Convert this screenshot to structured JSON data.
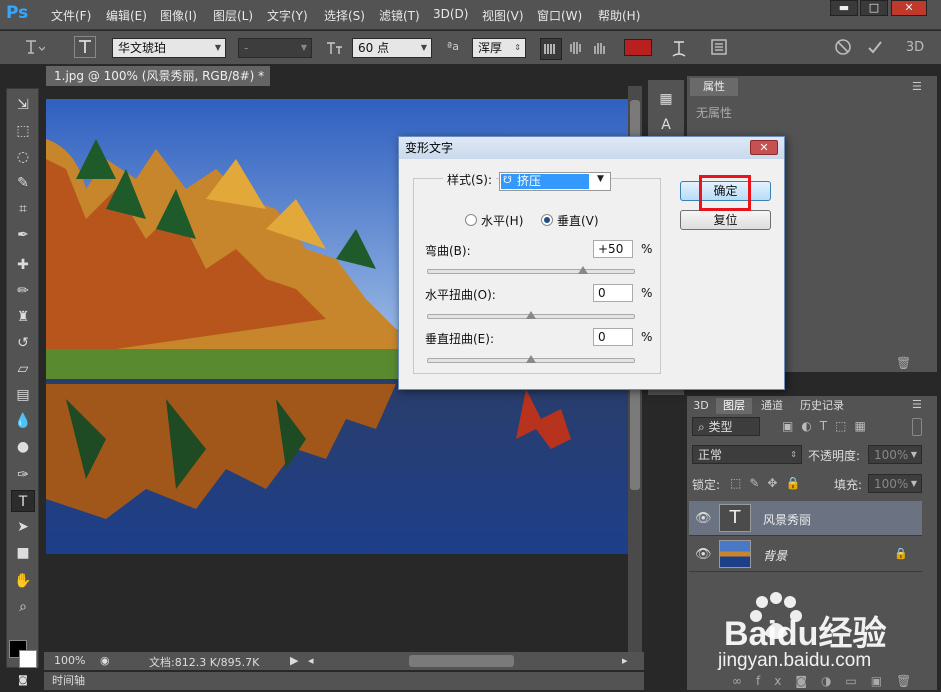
{
  "app": {
    "logo": "Ps"
  },
  "menu": [
    "文件(F)",
    "编辑(E)",
    "图像(I)",
    "图层(L)",
    "文字(Y)",
    "选择(S)",
    "滤镜(T)",
    "3D(D)",
    "视图(V)",
    "窗口(W)",
    "帮助(H)"
  ],
  "window_controls": {
    "minimize": "▬",
    "maximize": "□",
    "close": "✕"
  },
  "options": {
    "font_family": "华文琥珀",
    "font_style": "-",
    "font_size": "60 点",
    "antialias": "浑厚",
    "text_color": "#b82020"
  },
  "document": {
    "tab_title": "1.jpg @ 100% (风景秀丽, RGB/8#) *",
    "close": "×",
    "zoom": "100%",
    "doc_info": "文档:812.3 K/895.7K",
    "timeline": "时间轴"
  },
  "properties": {
    "tab": "属性",
    "content": "无属性"
  },
  "layers": {
    "tabs": [
      "3D",
      "图层",
      "通道",
      "历史记录"
    ],
    "filter": "类型",
    "blend_mode": "正常",
    "opacity_label": "不透明度:",
    "opacity": "100%",
    "lock_label": "锁定:",
    "fill_label": "填充:",
    "fill": "100%",
    "items": [
      {
        "name": "风景秀丽",
        "type": "text",
        "selected": true
      },
      {
        "name": "背景",
        "type": "image",
        "selected": false
      }
    ]
  },
  "dialog": {
    "title": "变形文字",
    "close": "✕",
    "style_label": "样式(S):",
    "style_value": "挤压",
    "horizontal": "水平(H)",
    "vertical": "垂直(V)",
    "orientation": "vertical",
    "bend_label": "弯曲(B):",
    "bend": "+50",
    "h_distort_label": "水平扭曲(O):",
    "h_distort": "0",
    "v_distort_label": "垂直扭曲(E):",
    "v_distort": "0",
    "percent": "%",
    "ok": "确定",
    "reset": "复位"
  },
  "watermark": {
    "brand": "Baidu经验",
    "url": "jingyan.baidu.com"
  }
}
